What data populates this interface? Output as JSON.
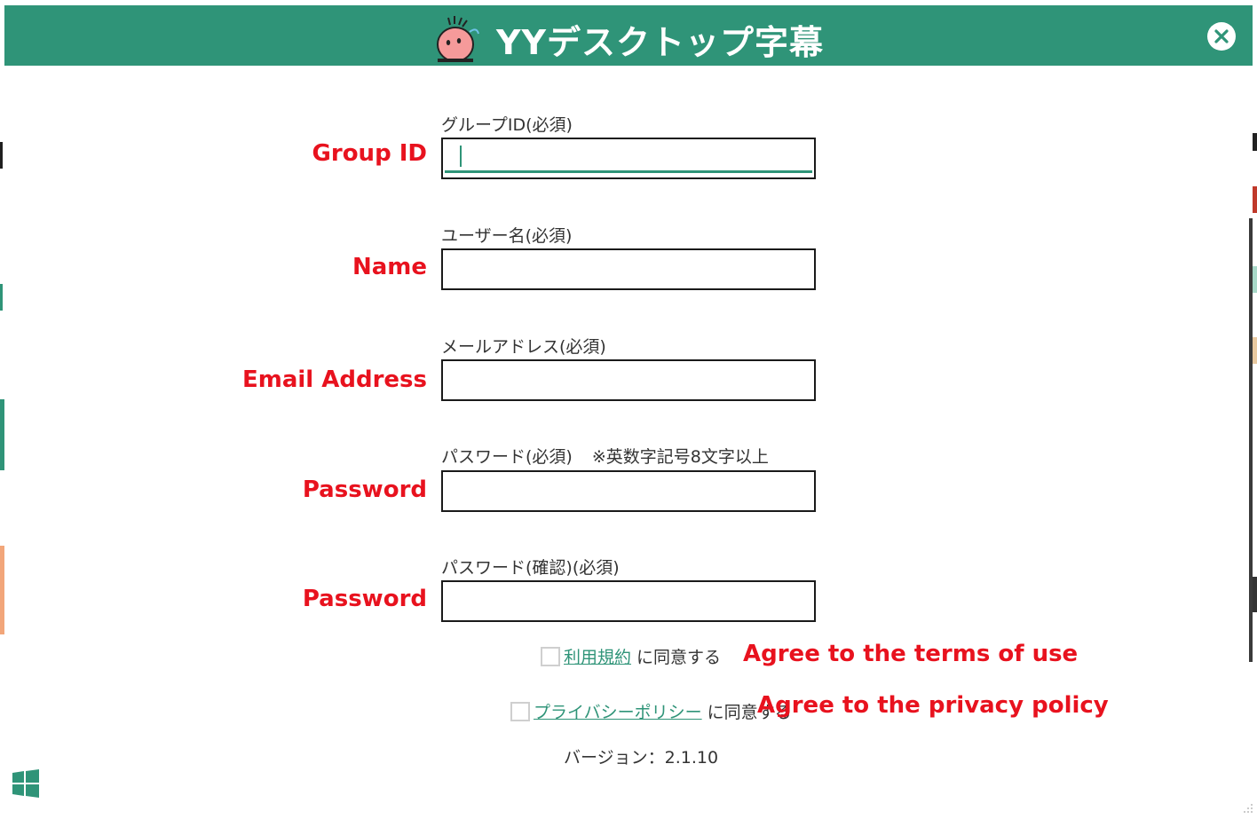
{
  "window": {
    "title": "YYデスクトップ字幕",
    "title_color": "#2f9478",
    "close_icon": "close-icon"
  },
  "fields": [
    {
      "caption": "グループID(必須)",
      "value": "",
      "annotation": "Group ID"
    },
    {
      "caption": "ユーザー名(必須)",
      "value": "",
      "annotation": "Name"
    },
    {
      "caption": "メールアドレス(必須)",
      "value": "",
      "annotation": "Email Address"
    },
    {
      "caption": "パスワード(必須)",
      "note": "※英数字記号8文字以上",
      "value": "",
      "annotation": "Password"
    },
    {
      "caption": "パスワード(確認)(必須)",
      "value": "",
      "annotation": "Password"
    }
  ],
  "agreements": {
    "terms": {
      "link": "利用規約",
      "suffix": "に同意する",
      "annotation": "Agree to the terms of use",
      "checked": false
    },
    "privacy": {
      "link": "プライバシーポリシー",
      "suffix": "に同意する",
      "annotation": "Agree to the privacy policy",
      "checked": false
    }
  },
  "version": "バージョン：2.1.10",
  "colors": {
    "accent": "#2f9478",
    "annotation": "#e8121e",
    "border": "#1a1a1a"
  }
}
